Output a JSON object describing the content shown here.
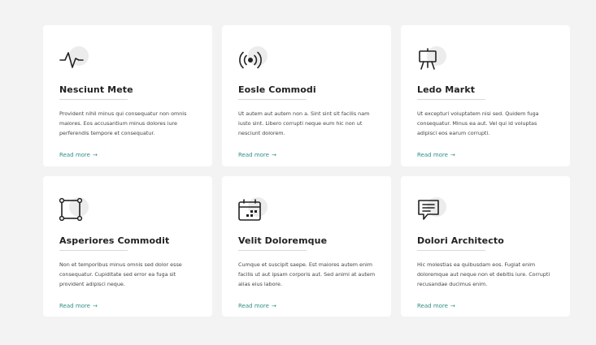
{
  "services": [
    {
      "icon": "activity-icon",
      "title": "Nesciunt Mete",
      "description": "Provident nihil minus qui consequatur non omnis maiores. Eos accusantium minus dolores iure perferendis tempore et consequatur.",
      "link": "Read more"
    },
    {
      "icon": "broadcast-icon",
      "title": "Eosle Commodi",
      "description": "Ut autem aut autem non a. Sint sint sit facilis nam iusto sint. Libero corrupti neque eum hic non ut nesciunt dolorem.",
      "link": "Read more"
    },
    {
      "icon": "easel-icon",
      "title": "Ledo Markt",
      "description": "Ut excepturi voluptatem nisi sed. Quidem fuga consequatur. Minus ea aut. Vel qui id voluptas adipisci eos earum corrupti.",
      "link": "Read more"
    },
    {
      "icon": "bounding-box-icon",
      "title": "Asperiores Commodit",
      "description": "Non et temporibus minus omnis sed dolor esse consequatur. Cupiditate sed error ea fuga sit provident adipisci neque.",
      "link": "Read more"
    },
    {
      "icon": "calendar-icon",
      "title": "Velit Doloremque",
      "description": "Cumque et suscipit saepe. Est maiores autem enim facilis ut aut ipsam corporis aut. Sed animi at autem alias eius labore.",
      "link": "Read more"
    },
    {
      "icon": "chat-text-icon",
      "title": "Dolori Architecto",
      "description": "Hic molestias ea quibusdam eos. Fugiat enim doloremque aut neque non et debitis iure. Corrupti recusandae ducimus enim.",
      "link": "Read more"
    }
  ],
  "theme": {
    "accent": "#2f8f87",
    "card_bg": "#ffffff",
    "page_bg": "#f3f3f3",
    "icon_blob": "#ececec"
  },
  "arrow_glyph": "→"
}
